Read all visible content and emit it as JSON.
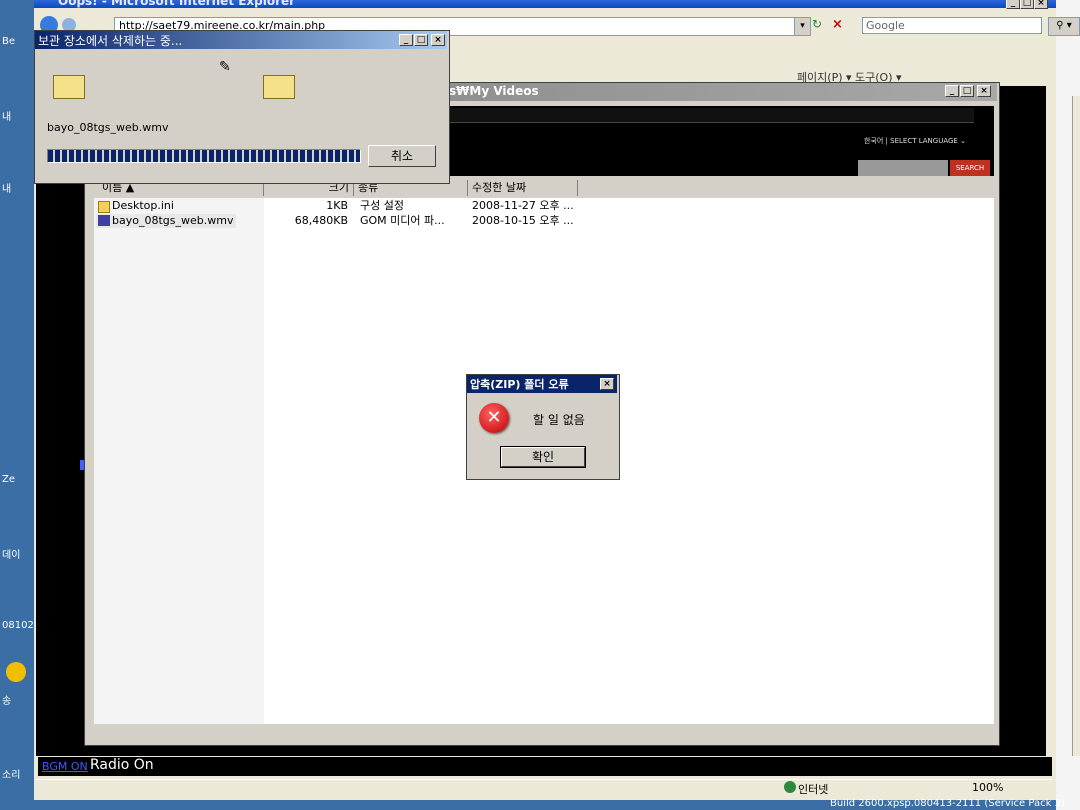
{
  "ie": {
    "title": "Oops! - Microsoft Internet Explorer",
    "address": "http://saet79.mireene.co.kr/main.php",
    "search_placeholder": "Google",
    "tools": "                  페이지(P) ▾   도구(O) ▾",
    "radio_logo": "BGM ON",
    "radio_label": "Radio On",
    "status_zone": "인터넷",
    "status_zoom": "100%",
    "build": "Build 2600.xpsp.080413-2111 (Service Pack 3)"
  },
  "website": {
    "language": "한국어 | SELECT LANGUAGE ⌄",
    "search_button": "SEARCH"
  },
  "explorer": {
    "title": "s₩My Videos",
    "columns": {
      "name": "이름 ▲",
      "size": "크기",
      "type": "종류",
      "modified": "수정한 날짜"
    },
    "files": [
      {
        "name": "Desktop.ini",
        "size": "1KB",
        "type": "구성 설정",
        "modified": "2008-11-27 오후 ..."
      },
      {
        "name": "bayo_08tgs_web.wmv",
        "size": "68,480KB",
        "type": "GOM 미디어 파...",
        "modified": "2008-10-15 오후 ..."
      }
    ]
  },
  "progress": {
    "title": "보관 장소에서 삭제하는 중...",
    "file": "bayo_08tgs_web.wmv",
    "cancel": "취소"
  },
  "error": {
    "title": "압축(ZIP) 폴더 오류",
    "message": "할 일 없음",
    "ok": "확인"
  },
  "desktop": {
    "labels": [
      "Be",
      "내",
      "내",
      "Ze",
      "데이",
      "08102",
      "송",
      "소리"
    ]
  }
}
